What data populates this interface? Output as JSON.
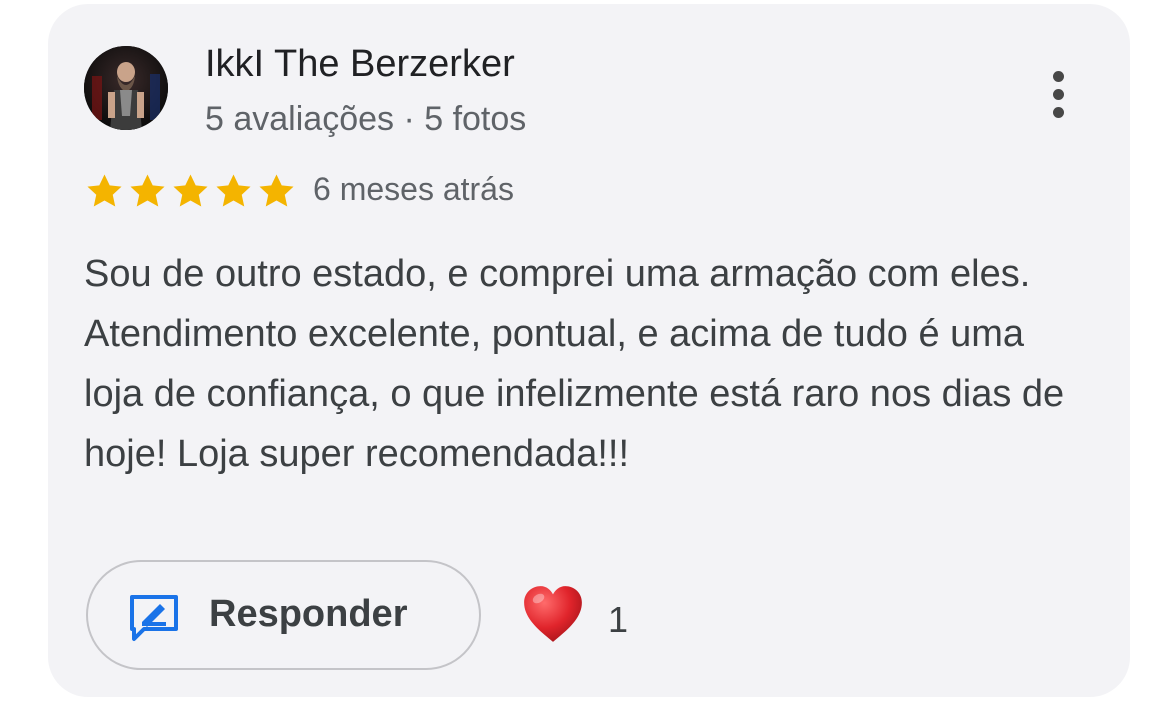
{
  "review": {
    "author_name": "IkkI The Berzerker",
    "author_meta": "5 avaliações · 5 fotos",
    "rating": 5,
    "rating_max": 5,
    "time_ago": "6 meses atrás",
    "text": "Sou de outro estado, e comprei uma armação com eles. Atendimento excelente, pontual, e acima de tudo é uma loja de confiança, o que infelizmente está raro nos dias de hoje! Loja super recomendada!!!"
  },
  "actions": {
    "reply_label": "Responder",
    "reaction_count": "1"
  },
  "icons": {
    "avatar": "user-avatar-photo",
    "more": "more-vert-icon",
    "star": "star-icon",
    "reply": "reply-edit-icon",
    "reaction": "heart-icon"
  },
  "colors": {
    "star": "#f4b400",
    "reply_icon": "#1a73e8",
    "heart": "#e0242b",
    "card_bg": "#f3f3f6"
  }
}
